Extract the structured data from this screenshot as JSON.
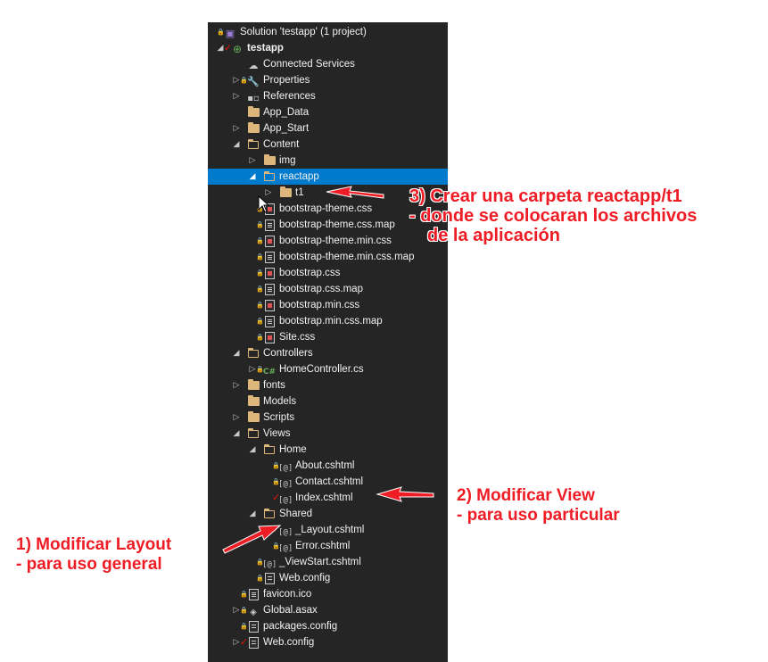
{
  "tree": {
    "rows": [
      {
        "label": "Solution 'testapp' (1 project)",
        "depth": 0,
        "arrow": "",
        "icon": "solution",
        "lock": true,
        "check": false,
        "bold": false
      },
      {
        "label": "testapp",
        "depth": 1,
        "arrow": "◢",
        "icon": "globe",
        "lock": false,
        "check": true,
        "bold": true
      },
      {
        "label": "Connected Services",
        "depth": 2,
        "arrow": "",
        "icon": "cloud",
        "lock": false,
        "check": false,
        "bold": false
      },
      {
        "label": "Properties",
        "depth": 2,
        "arrow": "▷",
        "icon": "wrench",
        "lock": true,
        "check": false,
        "bold": false
      },
      {
        "label": "References",
        "depth": 2,
        "arrow": "▷",
        "icon": "references",
        "lock": false,
        "check": false,
        "bold": false
      },
      {
        "label": "App_Data",
        "depth": 2,
        "arrow": "",
        "icon": "folder",
        "lock": false,
        "check": false,
        "bold": false
      },
      {
        "label": "App_Start",
        "depth": 2,
        "arrow": "▷",
        "icon": "folder",
        "lock": false,
        "check": false,
        "bold": false
      },
      {
        "label": "Content",
        "depth": 2,
        "arrow": "◢",
        "icon": "folder-open",
        "lock": false,
        "check": false,
        "bold": false
      },
      {
        "label": "img",
        "depth": 3,
        "arrow": "▷",
        "icon": "folder",
        "lock": false,
        "check": false,
        "bold": false
      },
      {
        "label": "reactapp",
        "depth": 3,
        "arrow": "◢",
        "icon": "folder-open",
        "lock": false,
        "check": false,
        "bold": false,
        "selected": true
      },
      {
        "label": "t1",
        "depth": 4,
        "arrow": "▷",
        "icon": "folder",
        "lock": false,
        "check": false,
        "bold": false
      },
      {
        "label": "bootstrap-theme.css",
        "depth": 3,
        "arrow": "",
        "icon": "css",
        "lock": true,
        "check": false,
        "bold": false
      },
      {
        "label": "bootstrap-theme.css.map",
        "depth": 3,
        "arrow": "",
        "icon": "file",
        "lock": true,
        "check": false,
        "bold": false
      },
      {
        "label": "bootstrap-theme.min.css",
        "depth": 3,
        "arrow": "",
        "icon": "css",
        "lock": true,
        "check": false,
        "bold": false
      },
      {
        "label": "bootstrap-theme.min.css.map",
        "depth": 3,
        "arrow": "",
        "icon": "file",
        "lock": true,
        "check": false,
        "bold": false
      },
      {
        "label": "bootstrap.css",
        "depth": 3,
        "arrow": "",
        "icon": "css",
        "lock": true,
        "check": false,
        "bold": false
      },
      {
        "label": "bootstrap.css.map",
        "depth": 3,
        "arrow": "",
        "icon": "file",
        "lock": true,
        "check": false,
        "bold": false
      },
      {
        "label": "bootstrap.min.css",
        "depth": 3,
        "arrow": "",
        "icon": "css",
        "lock": true,
        "check": false,
        "bold": false
      },
      {
        "label": "bootstrap.min.css.map",
        "depth": 3,
        "arrow": "",
        "icon": "file",
        "lock": true,
        "check": false,
        "bold": false
      },
      {
        "label": "Site.css",
        "depth": 3,
        "arrow": "",
        "icon": "css",
        "lock": true,
        "check": false,
        "bold": false
      },
      {
        "label": "Controllers",
        "depth": 2,
        "arrow": "◢",
        "icon": "folder-open",
        "lock": false,
        "check": false,
        "bold": false
      },
      {
        "label": "HomeController.cs",
        "depth": 3,
        "arrow": "▷",
        "icon": "cs",
        "lock": true,
        "check": false,
        "bold": false
      },
      {
        "label": "fonts",
        "depth": 2,
        "arrow": "▷",
        "icon": "folder",
        "lock": false,
        "check": false,
        "bold": false
      },
      {
        "label": "Models",
        "depth": 2,
        "arrow": "",
        "icon": "folder",
        "lock": false,
        "check": false,
        "bold": false
      },
      {
        "label": "Scripts",
        "depth": 2,
        "arrow": "▷",
        "icon": "folder",
        "lock": false,
        "check": false,
        "bold": false
      },
      {
        "label": "Views",
        "depth": 2,
        "arrow": "◢",
        "icon": "folder-open",
        "lock": false,
        "check": false,
        "bold": false
      },
      {
        "label": "Home",
        "depth": 3,
        "arrow": "◢",
        "icon": "folder-open",
        "lock": false,
        "check": false,
        "bold": false
      },
      {
        "label": "About.cshtml",
        "depth": 4,
        "arrow": "",
        "icon": "razor",
        "lock": true,
        "check": false,
        "bold": false
      },
      {
        "label": "Contact.cshtml",
        "depth": 4,
        "arrow": "",
        "icon": "razor",
        "lock": true,
        "check": false,
        "bold": false
      },
      {
        "label": "Index.cshtml",
        "depth": 4,
        "arrow": "",
        "icon": "razor",
        "lock": false,
        "check": true,
        "bold": false
      },
      {
        "label": "Shared",
        "depth": 3,
        "arrow": "◢",
        "icon": "folder-open",
        "lock": false,
        "check": false,
        "bold": false
      },
      {
        "label": "_Layout.cshtml",
        "depth": 4,
        "arrow": "",
        "icon": "razor",
        "lock": false,
        "check": true,
        "bold": false
      },
      {
        "label": "Error.cshtml",
        "depth": 4,
        "arrow": "",
        "icon": "razor",
        "lock": true,
        "check": false,
        "bold": false
      },
      {
        "label": "_ViewStart.cshtml",
        "depth": 3,
        "arrow": "",
        "icon": "razor",
        "lock": true,
        "check": false,
        "bold": false
      },
      {
        "label": "Web.config",
        "depth": 3,
        "arrow": "",
        "icon": "config",
        "lock": true,
        "check": false,
        "bold": false
      },
      {
        "label": "favicon.ico",
        "depth": 2,
        "arrow": "",
        "icon": "file",
        "lock": true,
        "check": false,
        "bold": false
      },
      {
        "label": "Global.asax",
        "depth": 2,
        "arrow": "▷",
        "icon": "asax",
        "lock": true,
        "check": false,
        "bold": false
      },
      {
        "label": "packages.config",
        "depth": 2,
        "arrow": "",
        "icon": "config",
        "lock": true,
        "check": false,
        "bold": false
      },
      {
        "label": "Web.config",
        "depth": 2,
        "arrow": "▷",
        "icon": "config",
        "lock": false,
        "check": true,
        "bold": false
      }
    ]
  },
  "annotations": {
    "step3": {
      "line1": "3) Crear una carpeta reactapp/t1",
      "line2": "- donde se colocaran los archivos",
      "line3": "de la aplicación"
    },
    "step2": {
      "line1": "2) Modificar View",
      "line2": "- para uso particular"
    },
    "step1": {
      "line1": "1) Modificar Layout",
      "line2": "- para uso general"
    }
  },
  "colors": {
    "panel": "#252526",
    "selected": "#007acc",
    "annotation": "#ee1c24",
    "folder": "#dcb67a",
    "lock": "#3e9cd8"
  }
}
